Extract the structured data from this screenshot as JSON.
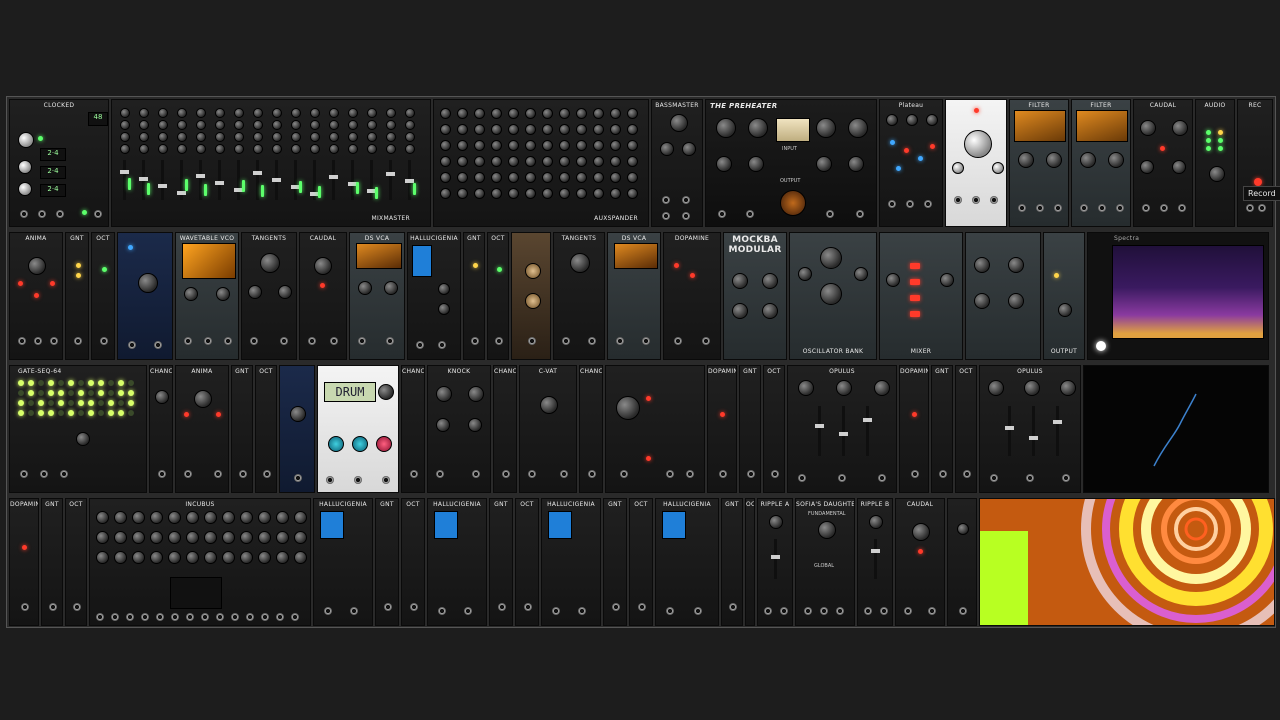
{
  "rack": {
    "rows": [
      {
        "modules": [
          {
            "name": "CLOCKED",
            "style": "dark",
            "display": [
              "48",
              "2·4",
              "2·4",
              "2·4"
            ]
          },
          {
            "name": "MIXMASTER",
            "style": "dark"
          },
          {
            "name": "AUXSPANDER",
            "style": "dark"
          },
          {
            "name": "BASSMASTER",
            "style": "dark"
          },
          {
            "name": "THE PREHEATER",
            "style": "dark"
          },
          {
            "name": "Plateau",
            "style": "dark"
          },
          {
            "name": "",
            "style": "light"
          },
          {
            "name": "FILTER",
            "style": "teal"
          },
          {
            "name": "FILTER",
            "style": "teal"
          },
          {
            "name": "CAUDAL",
            "style": "dark"
          },
          {
            "name": "AUDIO",
            "style": "dark"
          },
          {
            "name": "REC",
            "style": "dark"
          }
        ]
      },
      {
        "modules": [
          {
            "name": "ANIMA",
            "style": "dark"
          },
          {
            "name": "GNT",
            "style": "dark"
          },
          {
            "name": "OCT",
            "style": "dark"
          },
          {
            "name": "",
            "style": "navy"
          },
          {
            "name": "WAVETABLE VCO",
            "style": "teal"
          },
          {
            "name": "TANGENTS",
            "style": "dark"
          },
          {
            "name": "CAUDAL",
            "style": "dark"
          },
          {
            "name": "DS VCA",
            "style": "teal"
          },
          {
            "name": "HALLUCIGENIA",
            "style": "dark"
          },
          {
            "name": "GNT",
            "style": "dark"
          },
          {
            "name": "OCT",
            "style": "dark"
          },
          {
            "name": "",
            "style": "dark"
          },
          {
            "name": "TANGENTS",
            "style": "dark"
          },
          {
            "name": "DS VCA",
            "style": "teal"
          },
          {
            "name": "DOPAMINE",
            "style": "dark"
          },
          {
            "name": "MOCKBA MODULAR",
            "style": "teal"
          },
          {
            "name": "OSCILLATOR BANK",
            "style": "teal"
          },
          {
            "name": "MIXER",
            "style": "teal"
          },
          {
            "name": "OUTPUT",
            "style": "teal"
          },
          {
            "name": "Spectra",
            "style": "dark"
          }
        ]
      },
      {
        "modules": [
          {
            "name": "GATE-SEQ-64",
            "style": "dark"
          },
          {
            "name": "CHANCES",
            "style": "dark"
          },
          {
            "name": "ANIMA",
            "style": "dark"
          },
          {
            "name": "GNT",
            "style": "dark"
          },
          {
            "name": "OCT",
            "style": "dark"
          },
          {
            "name": "",
            "style": "navy"
          },
          {
            "name": "",
            "style": "light",
            "display": [
              "DRUM"
            ]
          },
          {
            "name": "CHANCES",
            "style": "dark"
          },
          {
            "name": "KNOCK",
            "style": "dark"
          },
          {
            "name": "CHANCES",
            "style": "dark"
          },
          {
            "name": "C-VAT",
            "style": "dark"
          },
          {
            "name": "CHANCES",
            "style": "dark"
          },
          {
            "name": "DOPAMINE",
            "style": "dark"
          },
          {
            "name": "GNT",
            "style": "dark"
          },
          {
            "name": "OCT",
            "style": "dark"
          },
          {
            "name": "OPULUS",
            "style": "dark"
          },
          {
            "name": "DOPAMINE",
            "style": "dark"
          },
          {
            "name": "GNT",
            "style": "dark"
          },
          {
            "name": "OCT",
            "style": "dark"
          },
          {
            "name": "OPULUS",
            "style": "dark"
          }
        ]
      },
      {
        "modules": [
          {
            "name": "DOPAMINE",
            "style": "dark"
          },
          {
            "name": "GNT",
            "style": "dark"
          },
          {
            "name": "OCT",
            "style": "dark"
          },
          {
            "name": "INCUBUS",
            "style": "dark"
          },
          {
            "name": "HALLUCIGENIA",
            "style": "dark"
          },
          {
            "name": "GNT",
            "style": "dark"
          },
          {
            "name": "OCT",
            "style": "dark"
          },
          {
            "name": "HALLUCIGENIA",
            "style": "dark"
          },
          {
            "name": "GNT",
            "style": "dark"
          },
          {
            "name": "OCT",
            "style": "dark"
          },
          {
            "name": "HALLUCIGENIA",
            "style": "dark"
          },
          {
            "name": "GNT",
            "style": "dark"
          },
          {
            "name": "OCT",
            "style": "dark"
          },
          {
            "name": "HALLUCIGENIA",
            "style": "dark"
          },
          {
            "name": "GNT",
            "style": "dark"
          },
          {
            "name": "OCT",
            "style": "dark"
          },
          {
            "name": "RIPPLE A",
            "style": "dark"
          },
          {
            "name": "SOFIA'S DAUGHTER",
            "style": "dark"
          },
          {
            "name": "RIPPLE B",
            "style": "dark"
          },
          {
            "name": "CAUDAL",
            "style": "dark"
          },
          {
            "name": "",
            "style": "dark"
          }
        ]
      }
    ]
  },
  "labels": {
    "fundamental": "FUNDAMENTAL",
    "global": "GLOBAL",
    "input": "INPUT",
    "output": "OUTPUT"
  },
  "tooltip": {
    "record": "Record"
  },
  "colors": {
    "accent_green": "#5cff6b",
    "accent_red": "#ff3a2a",
    "visual_orange": "#c45a10",
    "visual_green": "#b8ff22"
  }
}
